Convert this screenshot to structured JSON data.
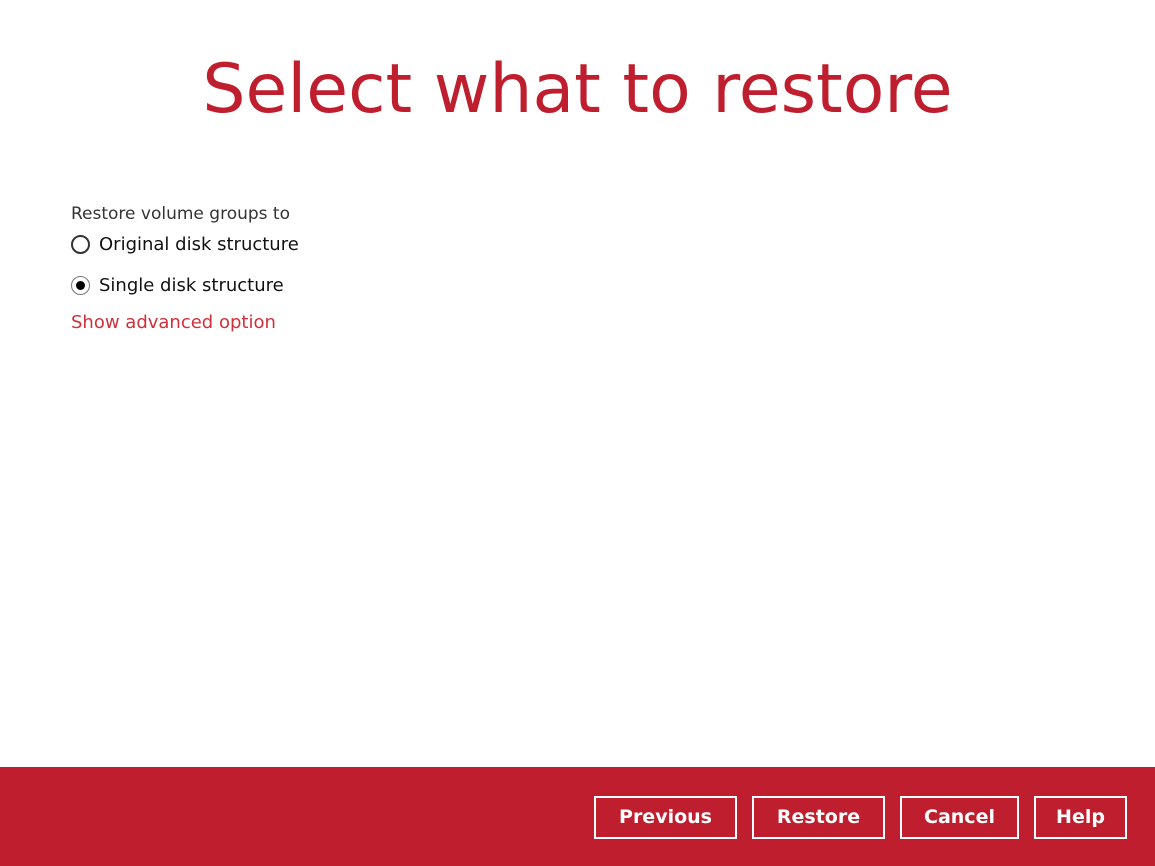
{
  "page": {
    "title": "Select what to restore"
  },
  "restore_options": {
    "label": "Restore volume groups to",
    "options": [
      {
        "label": "Original disk structure",
        "selected": false
      },
      {
        "label": "Single disk structure",
        "selected": true
      }
    ],
    "advanced_link": "Show advanced option"
  },
  "footer": {
    "previous_label": "Previous",
    "restore_label": "Restore",
    "cancel_label": "Cancel",
    "help_label": "Help"
  },
  "colors": {
    "accent": "#be1e2d",
    "link": "#d0303a",
    "background": "#ffffff"
  }
}
